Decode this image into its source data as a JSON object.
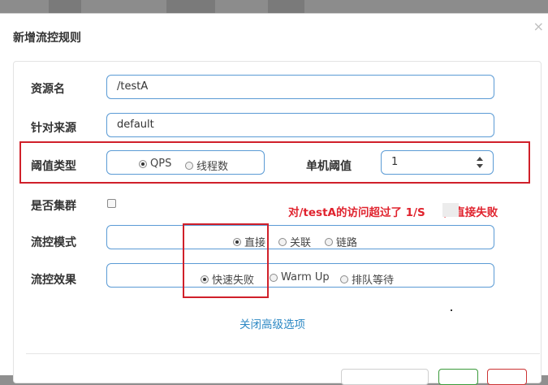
{
  "dialog": {
    "title": "新增流控规则",
    "close_icon": "close-icon"
  },
  "form": {
    "resource_name": {
      "label": "资源名",
      "value": "/testA"
    },
    "limit_app": {
      "label": "针对来源",
      "value": "default"
    },
    "threshold_type": {
      "label": "阈值类型",
      "options": [
        "QPS",
        "线程数"
      ],
      "selected": "QPS"
    },
    "single_threshold": {
      "label": "单机阈值",
      "value": "1"
    },
    "cluster": {
      "label": "是否集群",
      "checked": false
    },
    "flow_mode": {
      "label": "流控模式",
      "options": [
        "直接",
        "关联",
        "链路"
      ],
      "selected": "直接"
    },
    "control_effect": {
      "label": "流控效果",
      "options": [
        "快速失败",
        "Warm Up",
        "排队等待"
      ],
      "selected": "快速失败"
    },
    "advanced_link": "关闭高级选项"
  },
  "annotation": {
    "text_before": "对/testA的访问超过了 1/S",
    "text_after": "，直接失败",
    "color": "#e0232e"
  },
  "colors": {
    "field_border": "#5b9bd5",
    "link": "#2c88c4",
    "highlight_box": "#d0202a"
  }
}
